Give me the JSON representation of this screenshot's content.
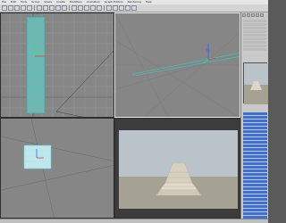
{
  "menu": {
    "items": [
      "File",
      "Edit",
      "Tools",
      "Group",
      "Views",
      "Create",
      "Modifiers",
      "Animation",
      "Graph Editors",
      "Rendering",
      "Help"
    ]
  },
  "toolbar": {
    "icons": [
      "undo-icon",
      "redo-icon",
      "link-icon",
      "unlink-icon",
      "bind-icon",
      "select-icon",
      "select-region-icon",
      "move-icon",
      "rotate-icon",
      "scale-icon",
      "snap-icon",
      "angle-snap-icon",
      "percent-snap-icon",
      "mirror-icon",
      "align-icon",
      "layers-icon",
      "curve-editor-icon",
      "material-editor-icon",
      "render-setup-icon",
      "render-icon"
    ]
  },
  "viewports": {
    "top": {
      "label": ""
    },
    "perspective": {
      "label": ""
    },
    "front": {
      "label": ""
    },
    "render": {
      "label": ""
    }
  },
  "colors": {
    "viewport_bg": "#868686",
    "grid_line": "#9a9a9a",
    "stair_cyan": "#4cd6d0",
    "gizmo_green": "#33e07a",
    "gizmo_blue": "#3a60ff",
    "sky": "#b9c3c9",
    "ground": "#a6a293",
    "stair_render": "#d9d2c2",
    "layer_highlight": "#3c6fd8"
  },
  "layers": {
    "items": [
      "",
      "",
      "",
      "",
      "",
      "",
      "",
      "",
      "",
      "",
      "",
      "",
      "",
      "",
      "",
      "",
      "",
      "",
      "",
      "",
      "",
      "",
      "",
      "",
      "",
      "",
      "",
      "",
      "",
      ""
    ]
  }
}
